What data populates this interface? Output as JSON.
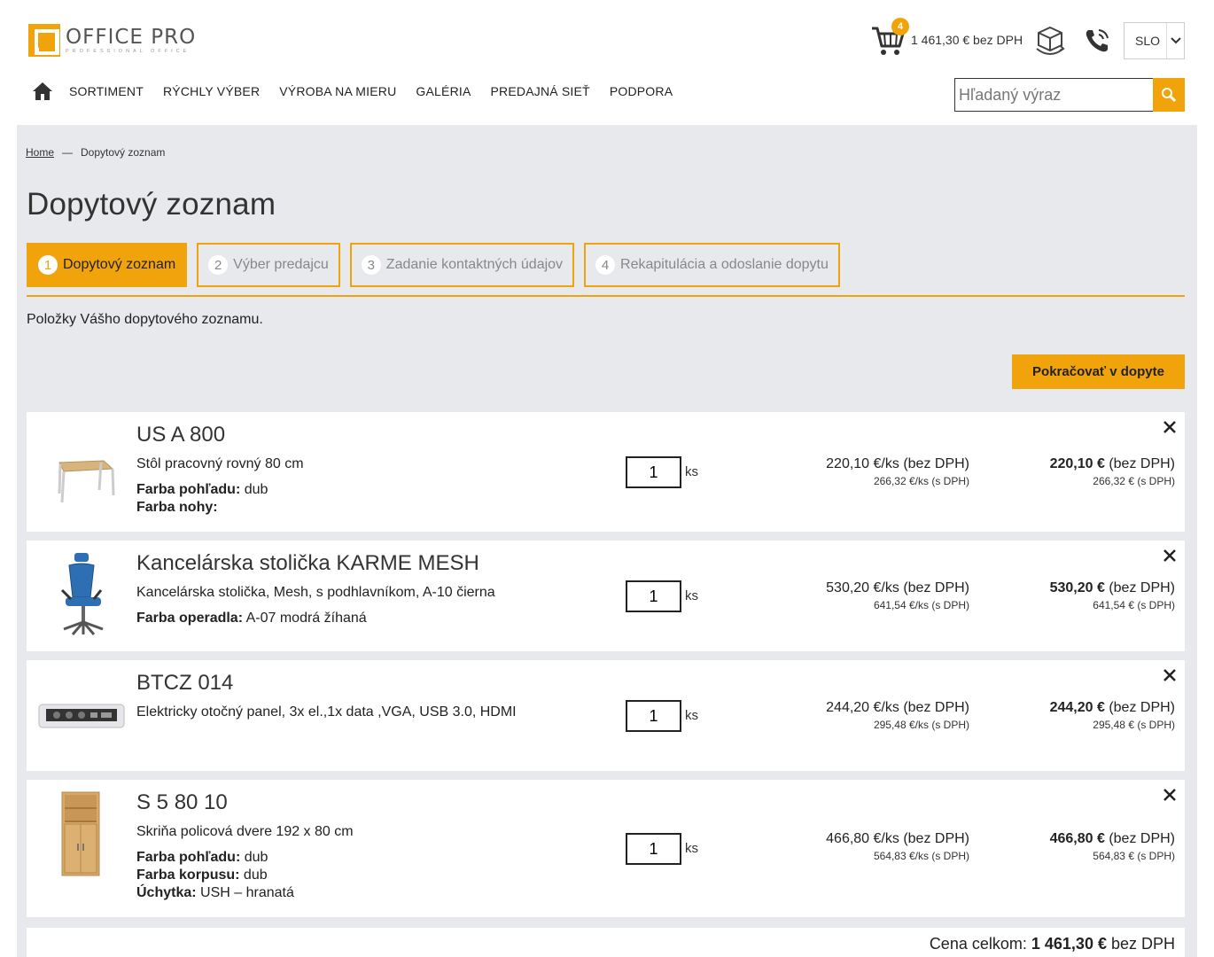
{
  "header": {
    "logo_title": "OFFICE PRO",
    "logo_sub": "PROFESSIONAL OFFICE",
    "cart_count": "4",
    "cart_total": "1 461,30 € bez DPH",
    "language": "SLO",
    "icons": {
      "cart": "cart-icon",
      "3d": "cube-3d-icon",
      "phone": "phone-icon",
      "search": "search-icon",
      "home": "home-icon"
    }
  },
  "nav": {
    "items": [
      "SORTIMENT",
      "RÝCHLY VÝBER",
      "VÝROBA NA MIERU",
      "GALÉRIA",
      "PREDAJNÁ SIEŤ",
      "PODPORA"
    ]
  },
  "search": {
    "placeholder": "Hľadaný výraz"
  },
  "breadcrumb": {
    "home": "Home",
    "current": "Dopytový zoznam"
  },
  "page_title": "Dopytový zoznam",
  "steps": [
    {
      "num": "1",
      "label": "Dopytový zoznam"
    },
    {
      "num": "2",
      "label": "Výber predajcu"
    },
    {
      "num": "3",
      "label": "Zadanie kontaktných údajov"
    },
    {
      "num": "4",
      "label": "Rekapitulácia a odoslanie dopytu"
    }
  ],
  "intro": "Položky Vášho dopytového zoznamu.",
  "continue_label": "Pokračovať v dopyte",
  "items": [
    {
      "name": "US A 800",
      "desc": "Stôl pracovný rovný 80 cm",
      "attrs": [
        {
          "k": "Farba pohľadu:",
          "v": " dub"
        },
        {
          "k": "Farba nohy:",
          "v": ""
        }
      ],
      "qty": "1",
      "unit": "ks",
      "unit_price": "220,10 €/ks (bez DPH)",
      "unit_price_vat": "266,32 €/ks (s DPH)",
      "total": "220,10 €",
      "total_suffix": " (bez DPH)",
      "total_vat": "266,32 € (s DPH)"
    },
    {
      "name": "Kancelárska stolička KARME MESH",
      "desc": "Kancelárska stolička, Mesh, s podhlavníkom, A-10 čierna",
      "attrs": [
        {
          "k": "Farba operadla:",
          "v": " A-07 modrá žíhaná"
        }
      ],
      "qty": "1",
      "unit": "ks",
      "unit_price": "530,20 €/ks (bez DPH)",
      "unit_price_vat": "641,54 €/ks (s DPH)",
      "total": "530,20 €",
      "total_suffix": " (bez DPH)",
      "total_vat": "641,54 € (s DPH)"
    },
    {
      "name": "BTCZ 014",
      "desc": "Elektricky otočný panel, 3x el.,1x data ,VGA, USB 3.0, HDMI",
      "attrs": [],
      "qty": "1",
      "unit": "ks",
      "unit_price": "244,20 €/ks (bez DPH)",
      "unit_price_vat": "295,48 €/ks (s DPH)",
      "total": "244,20 €",
      "total_suffix": " (bez DPH)",
      "total_vat": "295,48 € (s DPH)"
    },
    {
      "name": "S 5 80 10",
      "desc": "Skriňa policová dvere 192 x 80 cm",
      "attrs": [
        {
          "k": "Farba pohľadu:",
          "v": " dub"
        },
        {
          "k": "Farba korpusu:",
          "v": " dub"
        },
        {
          "k": "Úchytka:",
          "v": " USH – hranatá"
        }
      ],
      "qty": "1",
      "unit": "ks",
      "unit_price": "466,80 €/ks (bez DPH)",
      "unit_price_vat": "564,83 €/ks (s DPH)",
      "total": "466,80 €",
      "total_suffix": " (bez DPH)",
      "total_vat": "564,83 € (s DPH)"
    }
  ],
  "summary": {
    "label": "Cena celkom:",
    "value": "1 461,30 €",
    "suffix": " bez DPH"
  },
  "colors": {
    "accent": "#f0a30a",
    "background": "#e7e9ec"
  }
}
